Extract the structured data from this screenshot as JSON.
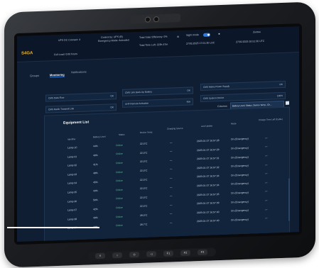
{
  "topbar": {
    "ups_connect": "UPS DC Connect: 4",
    "control": "Control by: UPS (B)",
    "emergency": "Emergency Mode: Activated",
    "total_eff_label": "Total Solar Efficiency: 0%",
    "night_mode": "Night mode",
    "user": "Zentee",
    "date_left": "27/01/2025 17:01:36 LOC",
    "date_right": "27/01/2025 16:51:36 UTC",
    "time_left": "Total Time Left: 223h 47m",
    "full_load": "Full Load: 0:00 hours",
    "logo": "S4GA"
  },
  "tabs": [
    "Groups",
    "Monitoring",
    "Notifications"
  ],
  "status_cards": [
    {
      "label": "CMS Data Flow",
      "value": "OK"
    },
    {
      "label": "CMS Link Back-Up Battery",
      "value": "OK"
    },
    {
      "label": "CMS Mains Power Supply",
      "value": "OK"
    },
    {
      "label": "CMS Radio Transmit Link",
      "value": "OK"
    },
    {
      "label": "UHF Remote Activation",
      "value": "N/A"
    },
    {
      "label": "CMS System Device",
      "value": "100%"
    }
  ],
  "columns": {
    "label": "Columns",
    "value": "Battery Level, Status, Device Temp., Ch..."
  },
  "table": {
    "title": "Equipment List",
    "headers": [
      "Identifier",
      "Battery Level",
      "Status",
      "Device Temp.",
      "Charging Source",
      "Last Update",
      "Mode",
      "Charge Time Left (Cable)"
    ],
    "rows": [
      [
        "Lamp 1C",
        "44%",
        "Online",
        "22.0°C",
        "—",
        "2025-01-27 16:57:28",
        "On (Emergency)",
        "—"
      ],
      [
        "Lamp 31",
        "40%",
        "Online",
        "22.0°C",
        "—",
        "2025-01-27 16:57:29",
        "On (Emergency)",
        "—"
      ],
      [
        "Lamp 32",
        "41%",
        "Online",
        "22.0°C",
        "—",
        "2025-01-27 16:57:31",
        "On (Emergency)",
        "—"
      ],
      [
        "Lamp 33",
        "48%",
        "Online",
        "22.0°C",
        "—",
        "2025-01-27 16:57:32",
        "On (Emergency)",
        "—"
      ],
      [
        "Lamp 34",
        "45%",
        "Online",
        "22.0°C",
        "—",
        "2025-01-27 16:57:34",
        "On (Emergency)",
        "—"
      ],
      [
        "Lamp 35",
        "43%",
        "Online",
        "22.0°C",
        "—",
        "2025-01-27 16:57:34",
        "On (Emergency)",
        "—"
      ],
      [
        "Lamp 36",
        "50%",
        "Online",
        "22.0°C",
        "—",
        "2025-01-27 16:57:35",
        "On (Emergency)",
        "—"
      ],
      [
        "Lamp 37",
        "42%",
        "Online",
        "22.0°C",
        "—",
        "2025-01-27 16:57:39",
        "On (Emergency)",
        "—"
      ],
      [
        "Lamp 38",
        "49%",
        "Online",
        "28.0°C",
        "—",
        "2025-01-27 16:57:40",
        "On (Emergency)",
        "—"
      ],
      [
        "Lamp 39",
        "43%",
        "Online",
        "28.7°C",
        "—",
        "2025-01-27 16:57:40",
        "On (Emergency)",
        "—"
      ]
    ]
  },
  "hw_buttons": [
    "≡",
    "⌂",
    "⊙",
    "◁",
    "F1",
    "F2",
    "F3"
  ],
  "colors": {
    "accent": "#2f7de1",
    "brand": "#f0b323",
    "ok": "#4cc38a",
    "bg": "#0f1e33"
  }
}
